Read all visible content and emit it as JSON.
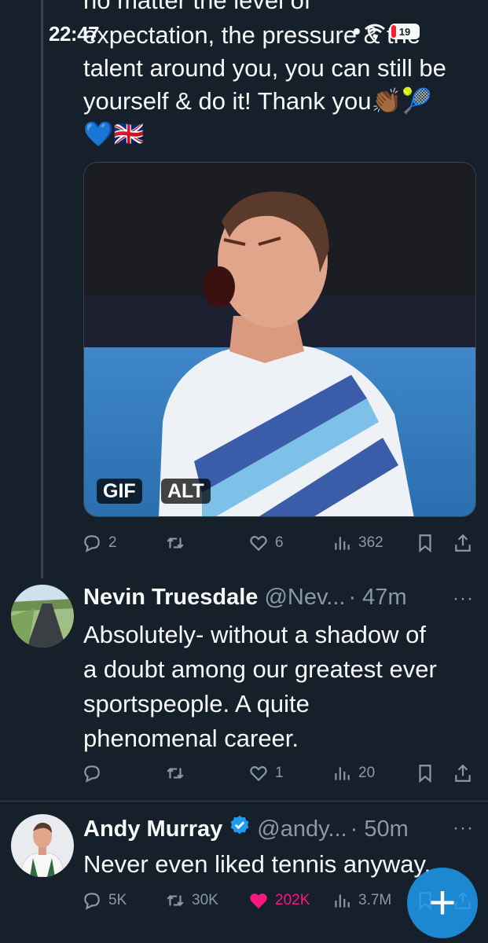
{
  "status_bar": {
    "time": "22:47",
    "battery": "19"
  },
  "tweet1": {
    "text_line0": "no matter the level of",
    "text_line1": "expectation, the pressure & the",
    "text_line2": "talent around you, you can still be",
    "text_line3": "yourself & do it! Thank you👏🏾🎾",
    "text_line4": "💙🇬🇧",
    "media": {
      "gif_badge": "GIF",
      "alt_badge": "ALT"
    },
    "actions": {
      "replies": "2",
      "reposts": "",
      "likes": "6",
      "views": "362"
    }
  },
  "tweet2": {
    "name": "Nevin Truesdale",
    "handle": "@Nev...",
    "time": "· 47m",
    "text_line1": "Absolutely- without a shadow of",
    "text_line2": "a doubt among our greatest ever",
    "text_line3": "sportspeople. A quite",
    "text_line4": "phenomenal career.",
    "actions": {
      "replies": "",
      "reposts": "",
      "likes": "1",
      "views": "20"
    }
  },
  "tweet3": {
    "name": "Andy Murray",
    "handle": "@andy...",
    "time": "· 50m",
    "text_line1": "Never even liked tennis anyway.",
    "actions": {
      "replies": "5K",
      "reposts": "30K",
      "likes": "202K",
      "views": "3.7M"
    }
  },
  "more_label": "···",
  "fab_label": "+",
  "colors": {
    "background": "#15202b",
    "text": "#f7f9f9",
    "muted": "#8b98a5",
    "like": "#f91880",
    "accent": "#1d9bf0"
  }
}
